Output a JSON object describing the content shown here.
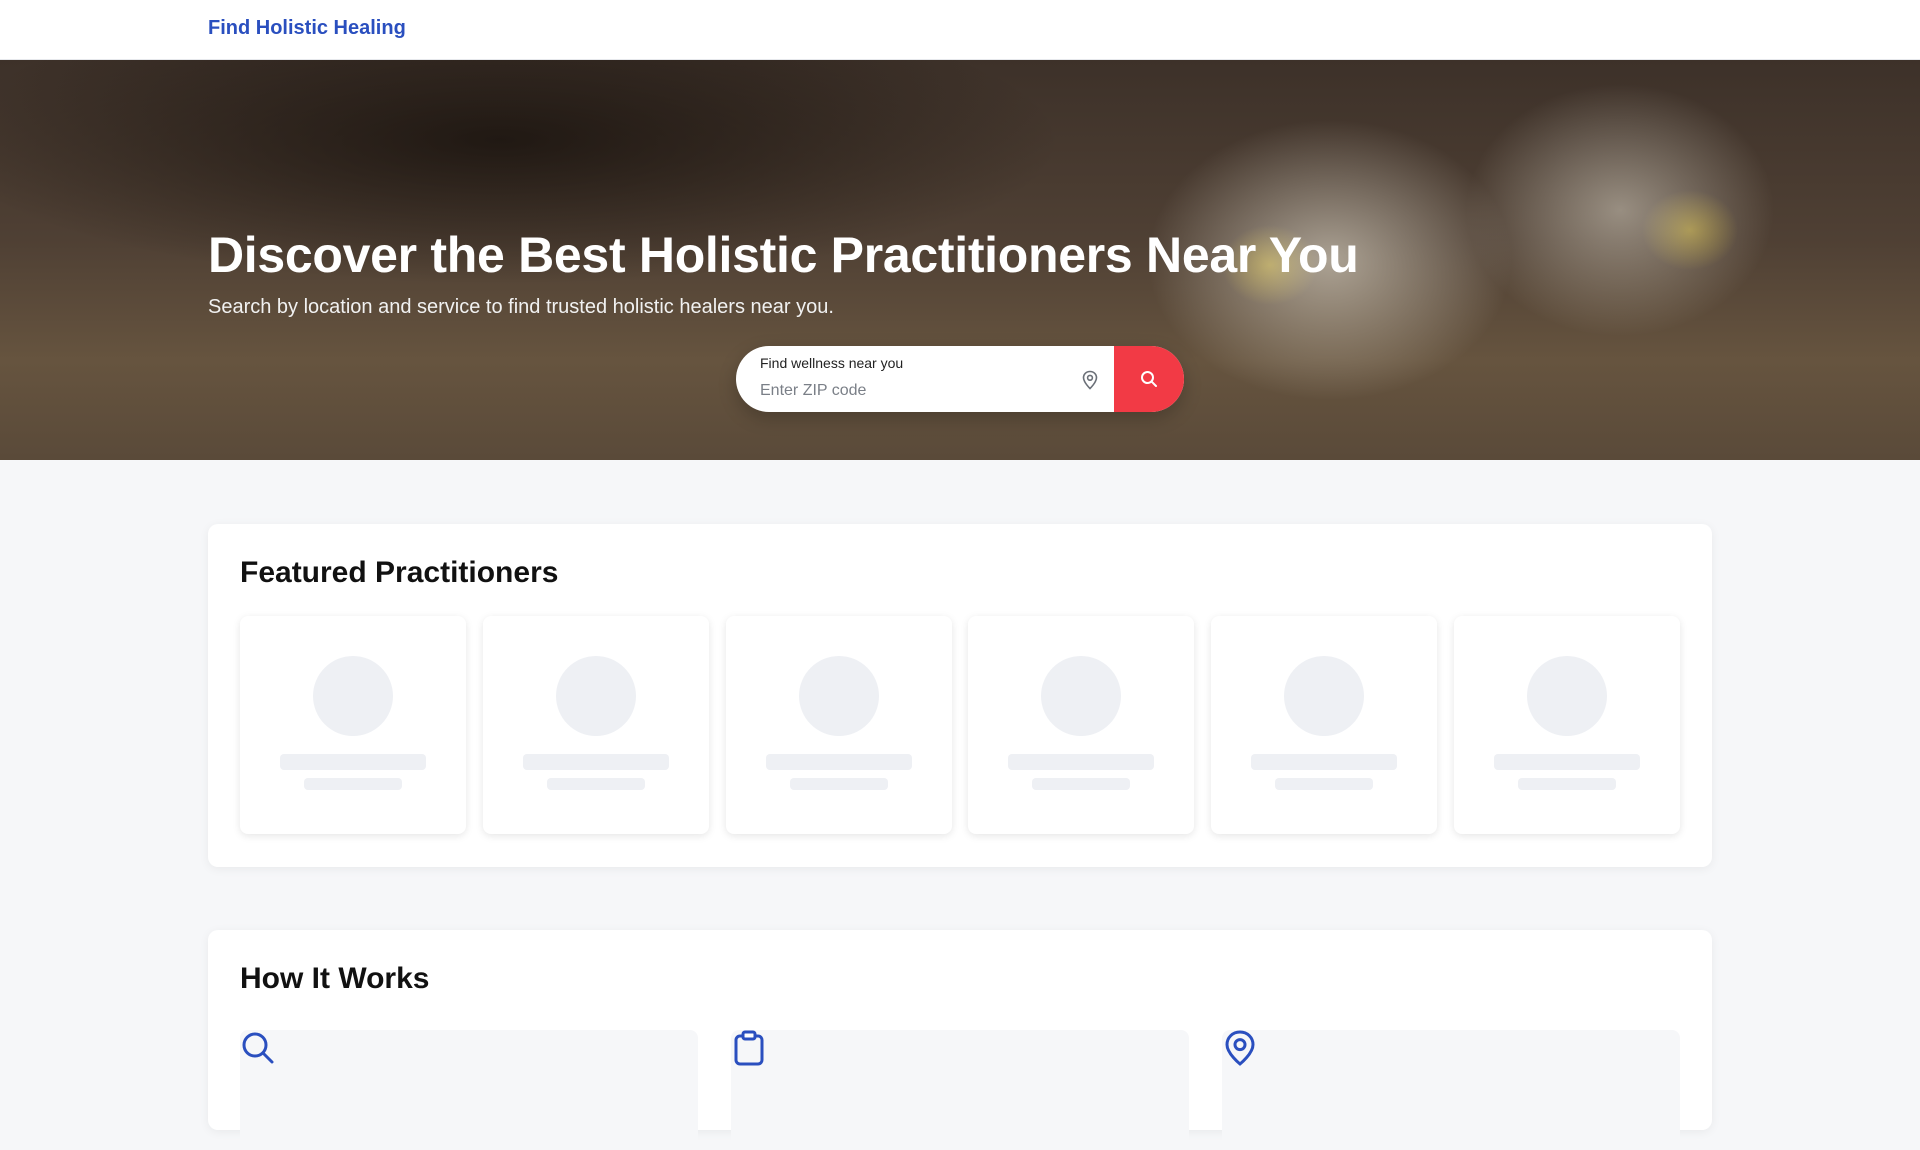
{
  "navbar": {
    "brand": "Find Holistic Healing"
  },
  "hero": {
    "title": "Discover the Best Holistic Practitioners Near You",
    "subtitle": "Search by location and service to find trusted holistic healers near you."
  },
  "search": {
    "label": "Find wellness near you",
    "placeholder": "Enter ZIP code",
    "value": "",
    "location_icon": "map-pin-icon",
    "button_icon": "search-icon"
  },
  "featured": {
    "title": "Featured Practitioners",
    "placeholder_count": 6
  },
  "how_it_works": {
    "title": "How It Works",
    "step_icons": [
      "search-icon",
      "clipboard-icon",
      "map-pin-icon"
    ]
  },
  "colors": {
    "brand": "#2a4fbf",
    "accent": "#f23a45",
    "skeleton": "#eef0f4",
    "page_bg": "#f6f7f9"
  }
}
